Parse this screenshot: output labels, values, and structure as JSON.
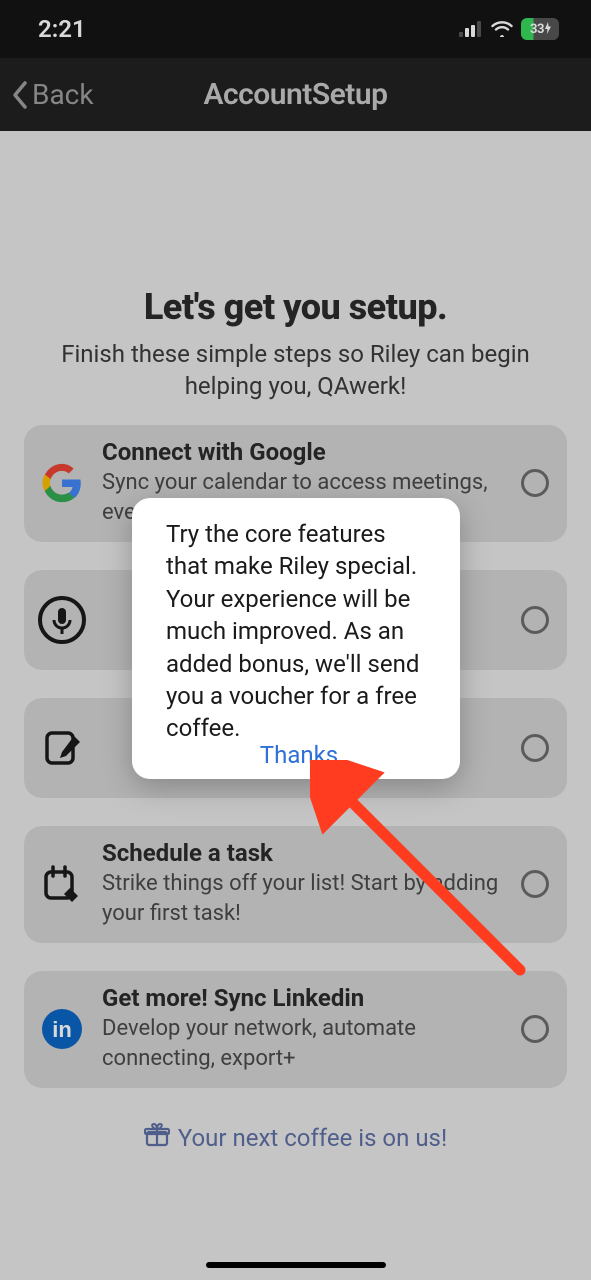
{
  "status_bar": {
    "time": "2:21",
    "battery": "33"
  },
  "nav": {
    "back_label": "Back",
    "title": "AccountSetup"
  },
  "header": {
    "title": "Let's get you setup.",
    "subtitle": "Finish these simple steps so Riley can begin helping you, QAwerk!"
  },
  "cards": [
    {
      "title": "Connect with Google",
      "desc": "Sync your calendar to access meetings, events"
    },
    {
      "title": "",
      "desc": ""
    },
    {
      "title": "",
      "desc": ""
    },
    {
      "title": "Schedule a task",
      "desc": "Strike things off your list! Start by adding your first task!"
    },
    {
      "title": "Get more! Sync Linkedin",
      "desc": "Develop your network, automate connecting, export+"
    }
  ],
  "footer": {
    "coffee": "Your next coffee is on us!"
  },
  "popup": {
    "text": "Try the core features that make Riley special. Your experience will be much improved. As an added bonus, we'll send you a voucher for a free coffee.",
    "button": "Thanks"
  }
}
